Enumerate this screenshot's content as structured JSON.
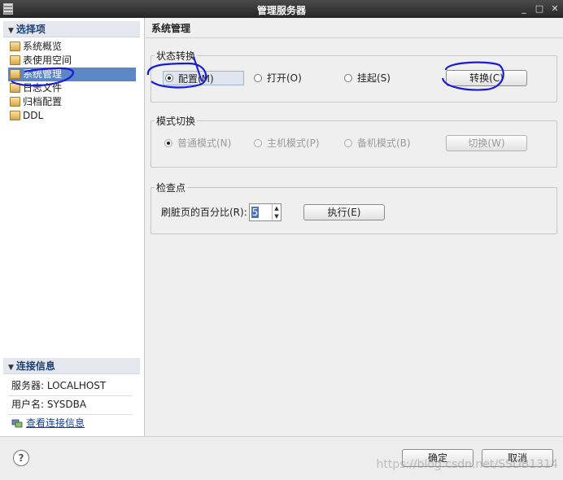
{
  "window": {
    "title": "管理服务器"
  },
  "left": {
    "section_title": "选择项",
    "nav_items": [
      {
        "label": "系统概览"
      },
      {
        "label": "表使用空间"
      },
      {
        "label": "系统管理"
      },
      {
        "label": "日志文件"
      },
      {
        "label": "归档配置"
      },
      {
        "label": "DDL"
      }
    ],
    "connection": {
      "title": "连接信息",
      "server": "服务器: LOCALHOST",
      "user": "用户名: SYSDBA",
      "view_link": "查看连接信息"
    }
  },
  "main": {
    "title": "系统管理",
    "state_switch": {
      "label": "状态转换",
      "options": [
        {
          "label": "配置(M)",
          "selected": true
        },
        {
          "label": "打开(O)",
          "selected": false
        },
        {
          "label": "挂起(S)",
          "selected": false
        }
      ],
      "button": "转换(C)"
    },
    "mode_switch": {
      "label": "模式切换",
      "options": [
        {
          "label": "普通模式(N)",
          "selected": true
        },
        {
          "label": "主机模式(P)",
          "selected": false
        },
        {
          "label": "备机模式(B)",
          "selected": false
        }
      ],
      "button": "切换(W)"
    },
    "checkpoint": {
      "label": "检查点",
      "field_label": "刷脏页的百分比(R):",
      "value": "5",
      "button": "执行(E)"
    }
  },
  "footer": {
    "help": "?",
    "ok": "确定",
    "cancel": "取消",
    "watermark": "https://blog.csdn.net/SSDB1314"
  }
}
